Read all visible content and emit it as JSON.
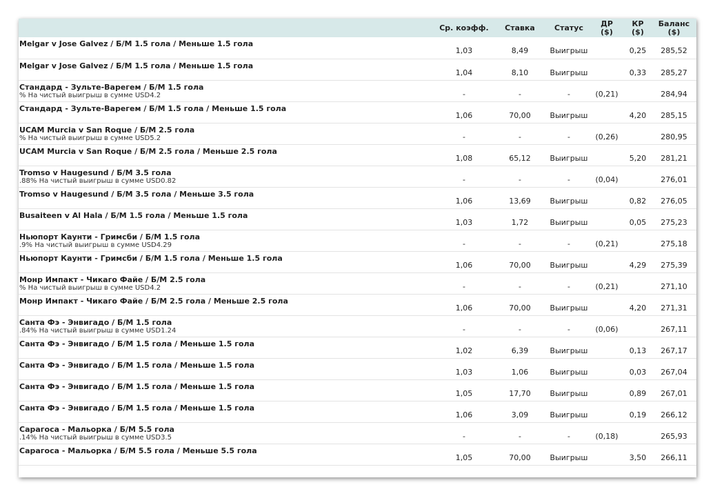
{
  "headers": {
    "odds": "Ср. коэфф.",
    "stake": "Ставка",
    "status": "Статус",
    "dr_line1": "ДР",
    "dr_line2": "($)",
    "kr_line1": "КР",
    "kr_line2": "($)",
    "bal_line1": "Баланс",
    "bal_line2": "($)"
  },
  "rows": [
    {
      "title": "Melgar v Jose Galvez / Б/М 1.5 гола / Меньше 1.5 гола",
      "sub": "",
      "odds": "1,03",
      "stake": "8,49",
      "status": "Выигрыш",
      "dr": "",
      "kr": "0,25",
      "balance": "285,52"
    },
    {
      "title": "Melgar v Jose Galvez / Б/М 1.5 гола / Меньше 1.5 гола",
      "sub": "",
      "odds": "1,04",
      "stake": "8,10",
      "status": "Выигрыш",
      "dr": "",
      "kr": "0,33",
      "balance": "285,27"
    },
    {
      "title": "Стандард - Зульте-Варегем / Б/М 1.5 гола",
      "sub": "% На чистый выигрыш в сумме USD4.2",
      "odds": "-",
      "stake": "-",
      "status": "-",
      "dr": "(0,21)",
      "kr": "",
      "balance": "284,94"
    },
    {
      "title": "Стандард - Зульте-Варегем / Б/М 1.5 гола / Меньше 1.5 гола",
      "sub": "",
      "odds": "1,06",
      "stake": "70,00",
      "status": "Выигрыш",
      "dr": "",
      "kr": "4,20",
      "balance": "285,15"
    },
    {
      "title": "UCAM Murcia v San Roque / Б/М 2.5 гола",
      "sub": "% На чистый выигрыш в сумме USD5.2",
      "odds": "-",
      "stake": "-",
      "status": "-",
      "dr": "(0,26)",
      "kr": "",
      "balance": "280,95"
    },
    {
      "title": "UCAM Murcia v San Roque / Б/М 2.5 гола / Меньше 2.5 гола",
      "sub": "",
      "odds": "1,08",
      "stake": "65,12",
      "status": "Выигрыш",
      "dr": "",
      "kr": "5,20",
      "balance": "281,21"
    },
    {
      "title": "Tromso v Haugesund / Б/М 3.5 гола",
      "sub": ".88% На чистый выигрыш в сумме USD0.82",
      "odds": "-",
      "stake": "-",
      "status": "-",
      "dr": "(0,04)",
      "kr": "",
      "balance": "276,01"
    },
    {
      "title": "Tromso v Haugesund / Б/М 3.5 гола / Меньше 3.5 гола",
      "sub": "",
      "odds": "1,06",
      "stake": "13,69",
      "status": "Выигрыш",
      "dr": "",
      "kr": "0,82",
      "balance": "276,05"
    },
    {
      "title": "Busaiteen v Al Hala / Б/М 1.5 гола / Меньше 1.5 гола",
      "sub": "",
      "odds": "1,03",
      "stake": "1,72",
      "status": "Выигрыш",
      "dr": "",
      "kr": "0,05",
      "balance": "275,23"
    },
    {
      "title": "Ньюпорт Каунти - Гримсби / Б/М 1.5 гола",
      "sub": ".9% На чистый выигрыш в сумме USD4.29",
      "odds": "-",
      "stake": "-",
      "status": "-",
      "dr": "(0,21)",
      "kr": "",
      "balance": "275,18"
    },
    {
      "title": "Ньюпорт Каунти - Гримсби / Б/М 1.5 гола / Меньше 1.5 гола",
      "sub": "",
      "odds": "1,06",
      "stake": "70,00",
      "status": "Выигрыш",
      "dr": "",
      "kr": "4,29",
      "balance": "275,39"
    },
    {
      "title": "Монр Импакт - Чикаго Файе / Б/М 2.5 гола",
      "sub": "% На чистый выигрыш в сумме USD4.2",
      "odds": "-",
      "stake": "-",
      "status": "-",
      "dr": "(0,21)",
      "kr": "",
      "balance": "271,10"
    },
    {
      "title": "Монр Импакт - Чикаго Файе / Б/М 2.5 гола / Меньше 2.5 гола",
      "sub": "",
      "odds": "1,06",
      "stake": "70,00",
      "status": "Выигрыш",
      "dr": "",
      "kr": "4,20",
      "balance": "271,31"
    },
    {
      "title": "Санта Фэ - Энвигадо / Б/М 1.5 гола",
      "sub": ".84% На чистый выигрыш в сумме USD1.24",
      "odds": "-",
      "stake": "-",
      "status": "-",
      "dr": "(0,06)",
      "kr": "",
      "balance": "267,11"
    },
    {
      "title": "Санта Фэ - Энвигадо / Б/М 1.5 гола / Меньше 1.5 гола",
      "sub": "",
      "odds": "1,02",
      "stake": "6,39",
      "status": "Выигрыш",
      "dr": "",
      "kr": "0,13",
      "balance": "267,17"
    },
    {
      "title": "Санта Фэ - Энвигадо / Б/М 1.5 гола / Меньше 1.5 гола",
      "sub": "",
      "odds": "1,03",
      "stake": "1,06",
      "status": "Выигрыш",
      "dr": "",
      "kr": "0,03",
      "balance": "267,04"
    },
    {
      "title": "Санта Фэ - Энвигадо / Б/М 1.5 гола / Меньше 1.5 гола",
      "sub": "",
      "odds": "1,05",
      "stake": "17,70",
      "status": "Выигрыш",
      "dr": "",
      "kr": "0,89",
      "balance": "267,01"
    },
    {
      "title": "Санта Фэ - Энвигадо / Б/М 1.5 гола / Меньше 1.5 гола",
      "sub": "",
      "odds": "1,06",
      "stake": "3,09",
      "status": "Выигрыш",
      "dr": "",
      "kr": "0,19",
      "balance": "266,12"
    },
    {
      "title": "Сарагоса - Мальорка / Б/М 5.5 гола",
      "sub": ".14% На чистый выигрыш в сумме USD3.5",
      "odds": "-",
      "stake": "-",
      "status": "-",
      "dr": "(0,18)",
      "kr": "",
      "balance": "265,93"
    },
    {
      "title": "Сарагоса - Мальорка / Б/М 5.5 гола / Меньше 5.5 гола",
      "sub": "",
      "odds": "1,05",
      "stake": "70,00",
      "status": "Выигрыш",
      "dr": "",
      "kr": "3,50",
      "balance": "266,11"
    }
  ]
}
